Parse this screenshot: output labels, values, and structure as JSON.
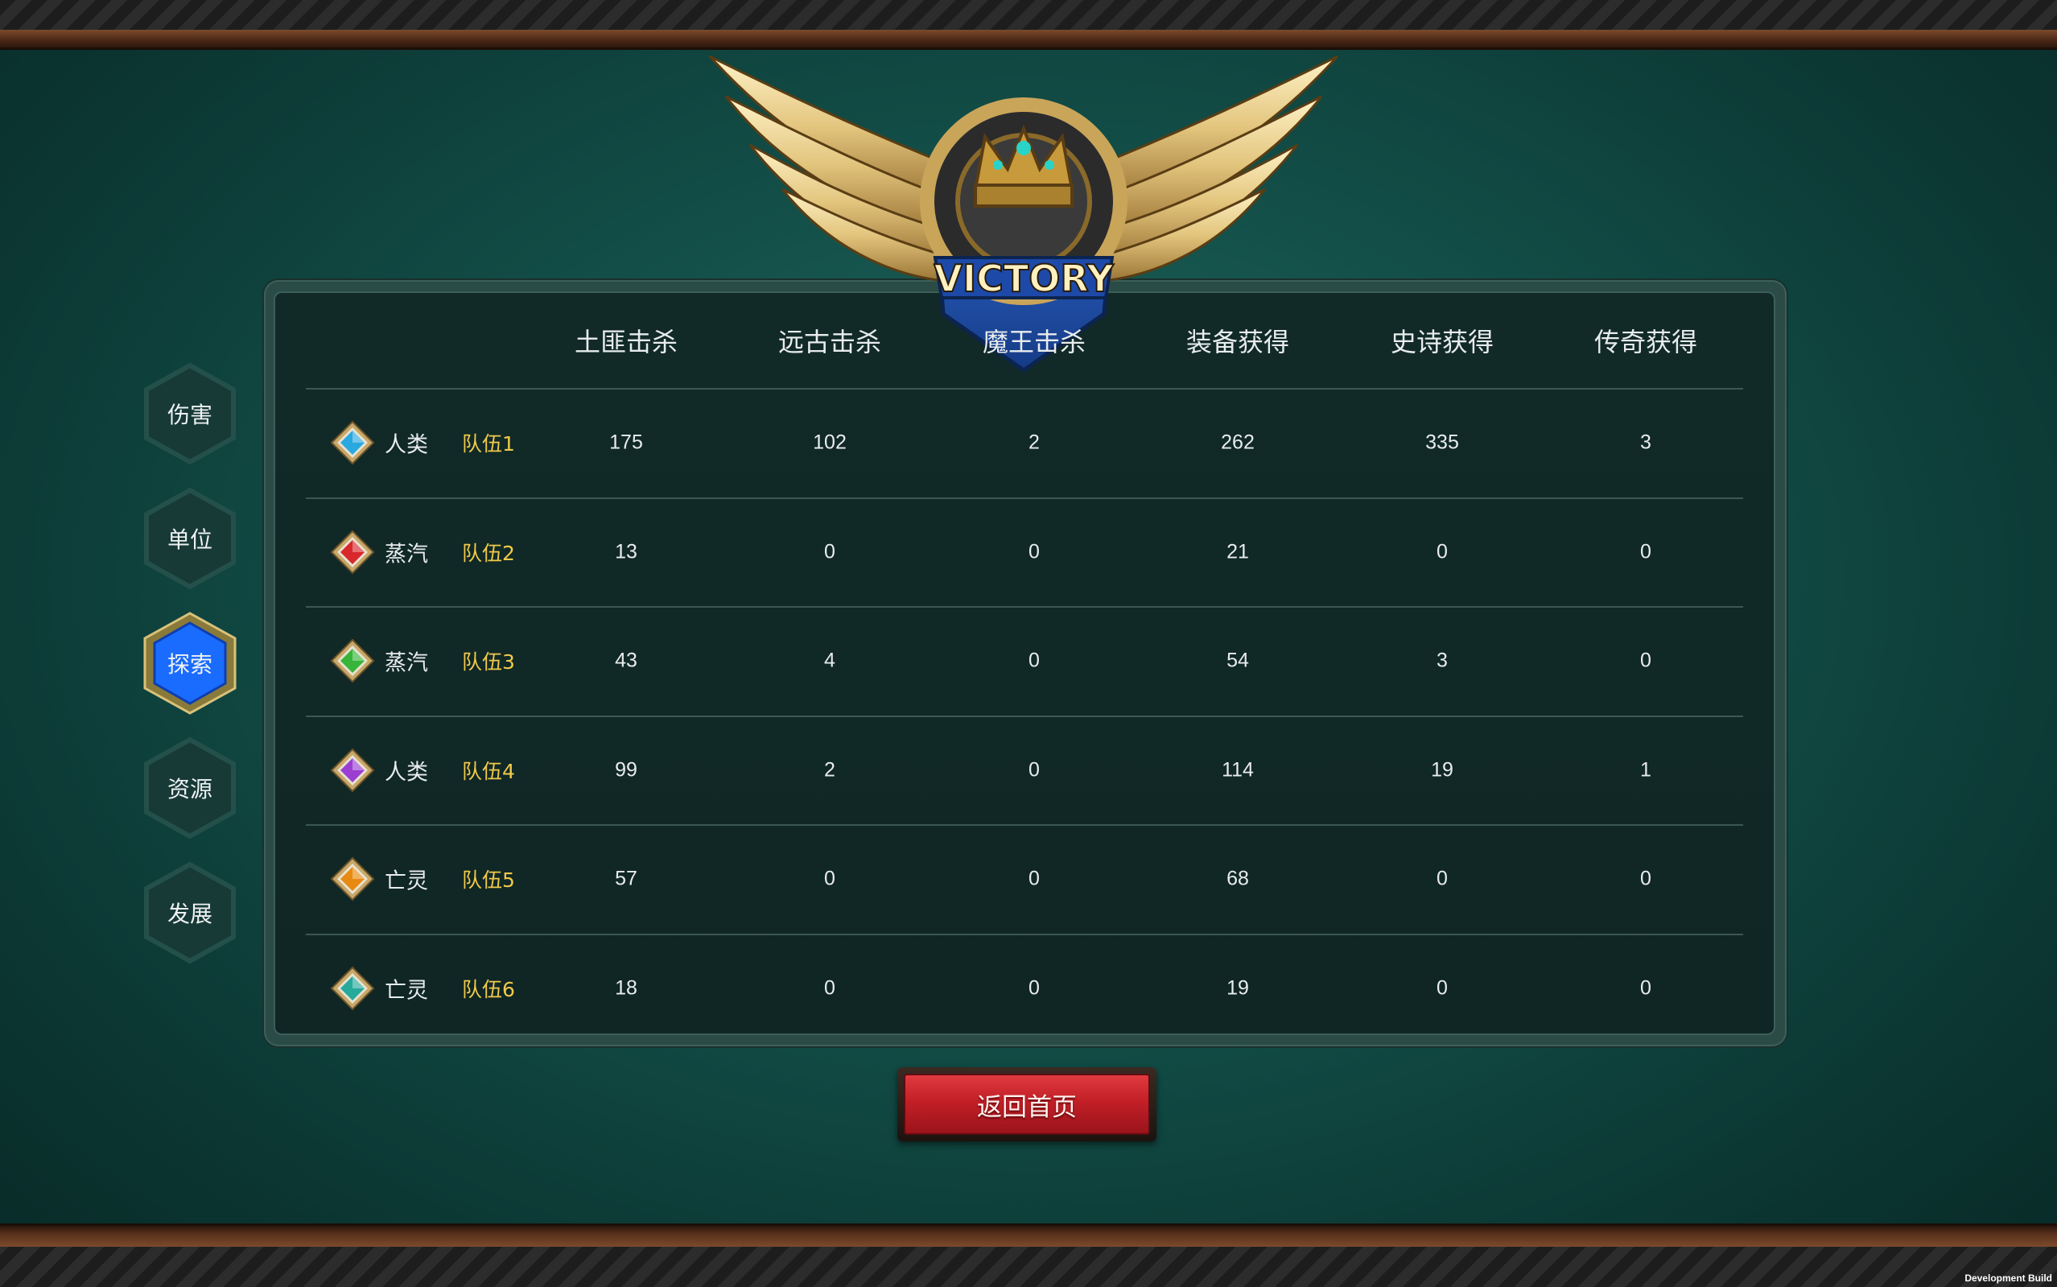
{
  "emblem": {
    "text": "VICTORY"
  },
  "side_tabs": [
    {
      "label": "伤害",
      "active": false
    },
    {
      "label": "单位",
      "active": false
    },
    {
      "label": "探索",
      "active": true
    },
    {
      "label": "资源",
      "active": false
    },
    {
      "label": "发展",
      "active": false
    }
  ],
  "table": {
    "headers": [
      "土匪击杀",
      "远古击杀",
      "魔王击杀",
      "装备获得",
      "史诗获得",
      "传奇获得"
    ],
    "rows": [
      {
        "gem_color": "#2aa8e0",
        "race": "人类",
        "team": "队伍1",
        "values": [
          "175",
          "102",
          "2",
          "262",
          "335",
          "3"
        ]
      },
      {
        "gem_color": "#d8282c",
        "race": "蒸汽",
        "team": "队伍2",
        "values": [
          "13",
          "0",
          "0",
          "21",
          "0",
          "0"
        ]
      },
      {
        "gem_color": "#37b53a",
        "race": "蒸汽",
        "team": "队伍3",
        "values": [
          "43",
          "4",
          "0",
          "54",
          "3",
          "0"
        ]
      },
      {
        "gem_color": "#9b3fd3",
        "race": "人类",
        "team": "队伍4",
        "values": [
          "99",
          "2",
          "0",
          "114",
          "19",
          "1"
        ]
      },
      {
        "gem_color": "#e88a12",
        "race": "亡灵",
        "team": "队伍5",
        "values": [
          "57",
          "0",
          "0",
          "68",
          "0",
          "0"
        ]
      },
      {
        "gem_color": "#27a99c",
        "race": "亡灵",
        "team": "队伍6",
        "values": [
          "18",
          "0",
          "0",
          "19",
          "0",
          "0"
        ]
      }
    ]
  },
  "return_button": {
    "label": "返回首页"
  },
  "footer": {
    "build_label": "Development Build"
  },
  "colors": {
    "team_label": "#f1c94a",
    "active_tab": "#1a6cff",
    "button_red": "#c21f27"
  }
}
